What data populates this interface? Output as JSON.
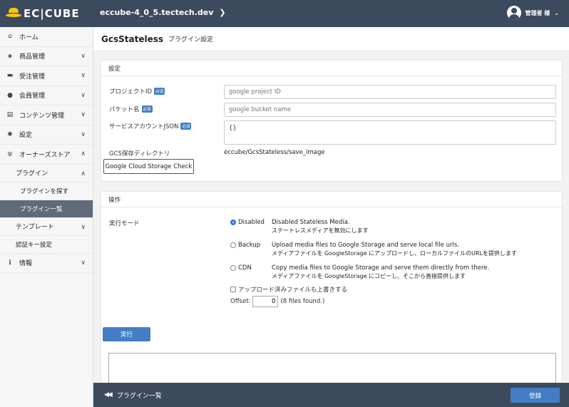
{
  "header": {
    "logo_text": "EC|CUBE",
    "site_name": "eccube-4_0_5.tectech.dev",
    "user_name": "管理者 様"
  },
  "sidebar": {
    "items": [
      {
        "label": "ホーム",
        "icon": "home-icon"
      },
      {
        "label": "商品管理",
        "icon": "cube-icon"
      },
      {
        "label": "受注管理",
        "icon": "cart-icon"
      },
      {
        "label": "会員管理",
        "icon": "users-icon"
      },
      {
        "label": "コンテンツ管理",
        "icon": "file-icon"
      },
      {
        "label": "設定",
        "icon": "gear-icon"
      },
      {
        "label": "オーナーズストア",
        "icon": "plug-icon"
      }
    ],
    "plugin_label": "プラグイン",
    "plugin_search": "プラグインを探す",
    "plugin_list": "プラグイン一覧",
    "template_label": "テンプレート",
    "auth_key": "認証キー設定",
    "info_label": "情報"
  },
  "page": {
    "title": "GcsStateless",
    "subtitle": "プラグイン設定"
  },
  "settings": {
    "heading": "設定",
    "required_badge": "必須",
    "project_label": "プロジェクトID",
    "project_placeholder": "google project ID",
    "bucket_label": "バケット名",
    "bucket_placeholder": "google bucket name",
    "json_label": "サービスアカウントJSON",
    "json_value": "{}",
    "dir_label": "GCS保存ディレクトリ",
    "dir_value": "eccube/GcsStateless/save_image",
    "check_button": "Google Cloud Storage Check"
  },
  "operation": {
    "heading": "操作",
    "mode_label": "実行モード",
    "options": [
      {
        "label": "Disabled",
        "desc_en": "Disabled Stateless Media.",
        "desc_jp": "ステートレスメディアを無効にします"
      },
      {
        "label": "Backup",
        "desc_en": "Upload media files to Google Storage and serve local file urls.",
        "desc_jp": "メディアファイルを GoogleStorage にアップロードし、ローカルファイルのURLを提供します"
      },
      {
        "label": "CDN",
        "desc_en": "Copy media files to Google Storage and serve them directly from there.",
        "desc_jp": "メディアファイルを GoogleStorage にコピーし、そこから直接提供します"
      }
    ],
    "overwrite_label": "アップロード済みファイルも上書きする",
    "offset_label": "Offset:",
    "offset_value": "0",
    "files_found": "(8 files found.)",
    "run_button": "実行"
  },
  "footer": {
    "back_label": "プラグイン一覧",
    "save_button": "登録"
  }
}
